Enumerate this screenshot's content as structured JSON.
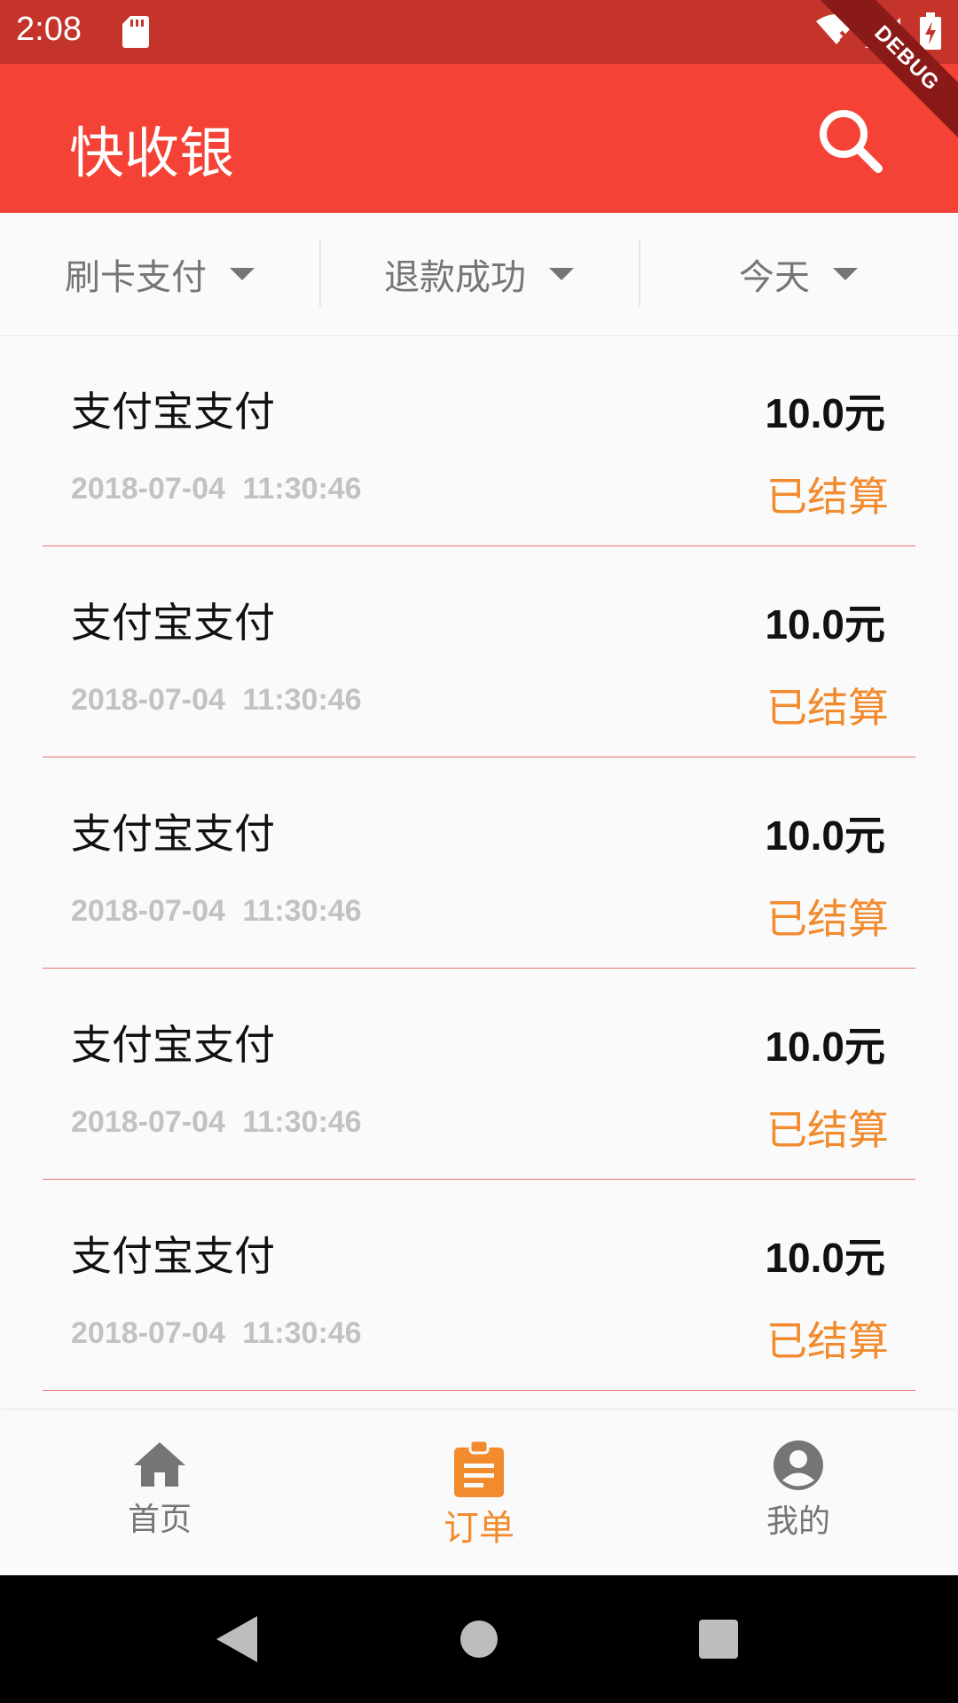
{
  "status_bar": {
    "time": "2:08",
    "icons": [
      "sd-card-icon",
      "wifi-icon",
      "signal-icon",
      "battery-charging-icon"
    ]
  },
  "debug_banner": {
    "label": "DEBUG"
  },
  "app_bar": {
    "title": "快收银",
    "search_icon": "search-icon"
  },
  "filters": [
    {
      "label": "刷卡支付",
      "icon": "dropdown-arrow-icon"
    },
    {
      "label": "退款成功",
      "icon": "dropdown-arrow-icon"
    },
    {
      "label": "今天",
      "icon": "dropdown-arrow-icon"
    }
  ],
  "orders": [
    {
      "type": "支付宝支付",
      "amount": "10.0元",
      "datetime": "2018-07-04 11:30:46",
      "status": "已结算"
    },
    {
      "type": "支付宝支付",
      "amount": "10.0元",
      "datetime": "2018-07-04 11:30:46",
      "status": "已结算"
    },
    {
      "type": "支付宝支付",
      "amount": "10.0元",
      "datetime": "2018-07-04 11:30:46",
      "status": "已结算"
    },
    {
      "type": "支付宝支付",
      "amount": "10.0元",
      "datetime": "2018-07-04 11:30:46",
      "status": "已结算"
    },
    {
      "type": "支付宝支付",
      "amount": "10.0元",
      "datetime": "2018-07-04 11:30:46",
      "status": "已结算"
    }
  ],
  "bottom_nav": [
    {
      "label": "首页",
      "icon": "home-icon",
      "active": false
    },
    {
      "label": "订单",
      "icon": "clipboard-icon",
      "active": true
    },
    {
      "label": "我的",
      "icon": "account-icon",
      "active": false
    }
  ],
  "colors": {
    "status_bar": "#c4342b",
    "app_bar": "#f44336",
    "accent": "#f28a2e",
    "divider": "#e57368",
    "muted_text": "#c2c2c2"
  }
}
